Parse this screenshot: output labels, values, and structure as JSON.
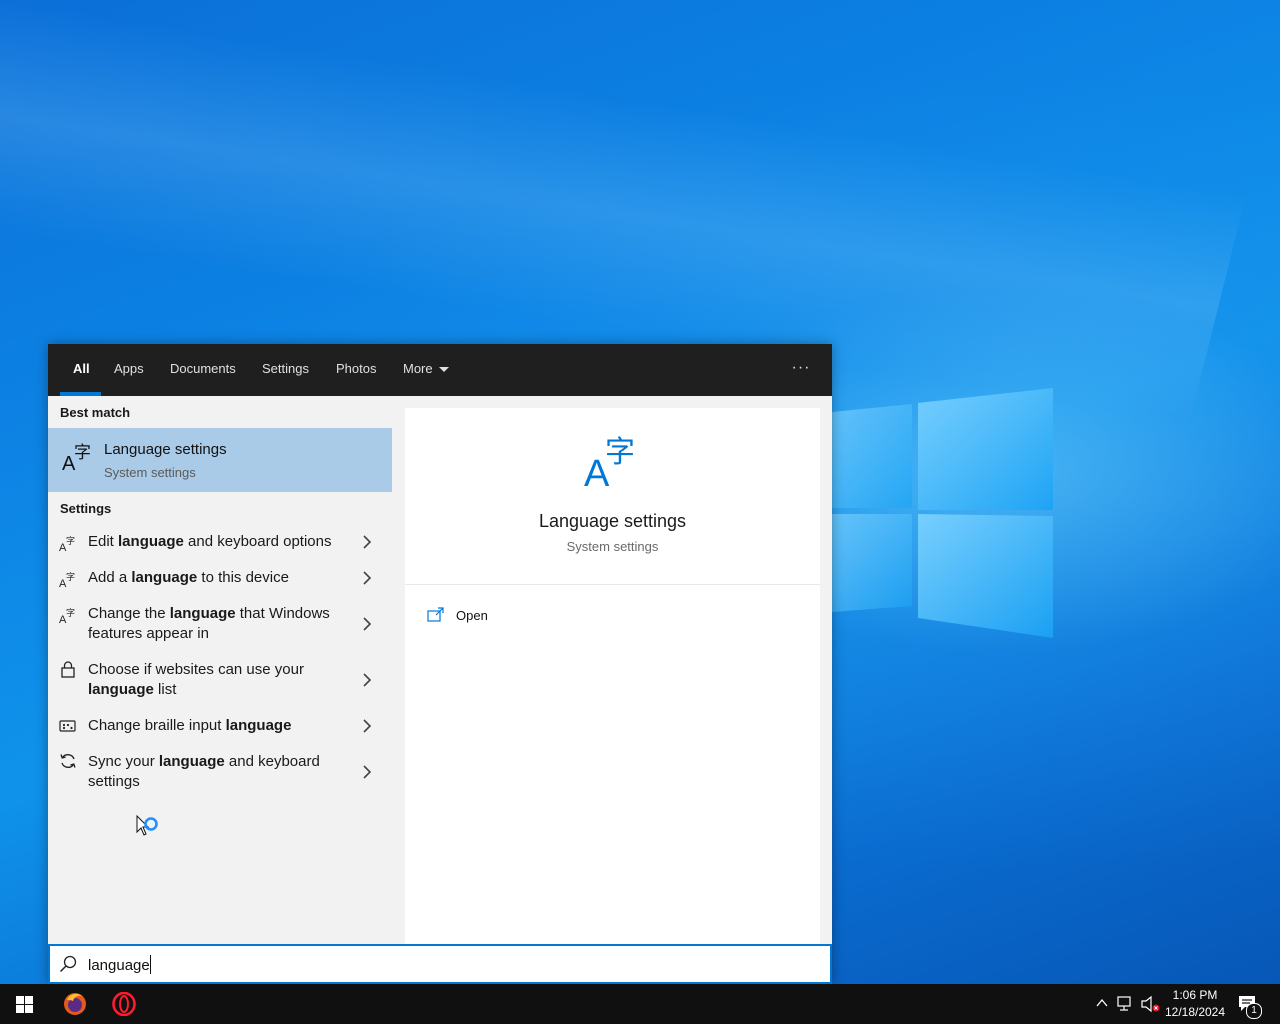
{
  "search": {
    "tabs": [
      {
        "label": "All",
        "active": true
      },
      {
        "label": "Apps"
      },
      {
        "label": "Documents"
      },
      {
        "label": "Settings"
      },
      {
        "label": "Photos"
      },
      {
        "label": "More"
      }
    ],
    "more_options": "···",
    "query": "language"
  },
  "results": {
    "best_match_heading": "Best match",
    "best_match": {
      "title": "Language settings",
      "subtitle": "System settings",
      "icon": "language-icon"
    },
    "settings_heading": "Settings",
    "items": [
      {
        "icon": "language-icon",
        "pre": "Edit ",
        "bold": "language",
        "post": " and keyboard options"
      },
      {
        "icon": "language-icon",
        "pre": "Add a ",
        "bold": "language",
        "post": " to this device"
      },
      {
        "icon": "language-icon",
        "pre": "Change the ",
        "bold": "language",
        "post": " that Windows features appear in"
      },
      {
        "icon": "lock-icon",
        "pre": "Choose if websites can use your ",
        "bold": "language",
        "post": " list"
      },
      {
        "icon": "braille-icon",
        "pre": "Change braille input ",
        "bold": "language",
        "post": ""
      },
      {
        "icon": "sync-icon",
        "pre": "Sync your ",
        "bold": "language",
        "post": " and keyboard settings"
      }
    ]
  },
  "preview": {
    "title": "Language settings",
    "subtitle": "System settings",
    "actions": [
      {
        "label": "Open",
        "icon": "open-icon"
      }
    ]
  },
  "taskbar": {
    "apps": [
      "start-icon",
      "firefox-icon",
      "opera-icon"
    ],
    "time": "1:06 PM",
    "date": "12/18/2024",
    "notification_count": "1"
  },
  "colors": {
    "accent": "#0078d7",
    "selected_bg": "#aacbe8",
    "tabbar_bg": "#1f1f1f"
  }
}
